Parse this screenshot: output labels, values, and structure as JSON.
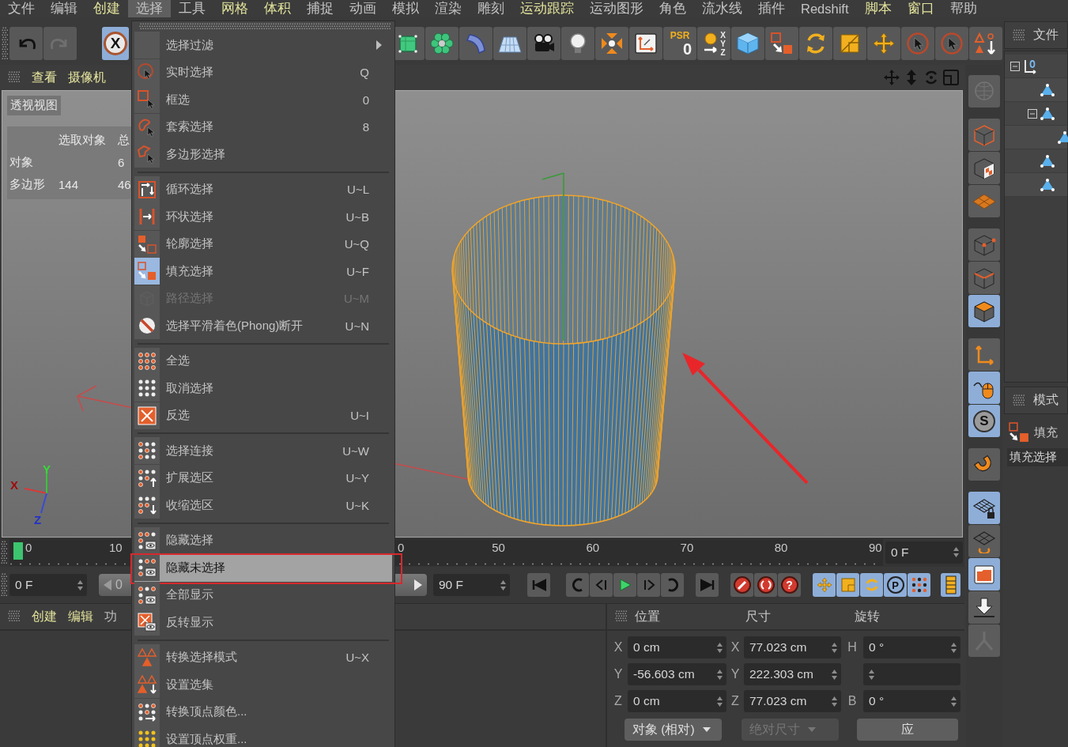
{
  "menu_bar": [
    {
      "label": "文件",
      "highlighted": false,
      "selected": false
    },
    {
      "label": "编辑",
      "highlighted": false,
      "selected": false
    },
    {
      "label": "创建",
      "highlighted": true,
      "selected": false
    },
    {
      "label": "选择",
      "highlighted": false,
      "selected": true
    },
    {
      "label": "工具",
      "highlighted": false,
      "selected": false
    },
    {
      "label": "网格",
      "highlighted": true,
      "selected": false
    },
    {
      "label": "体积",
      "highlighted": true,
      "selected": false
    },
    {
      "label": "捕捉",
      "highlighted": false,
      "selected": false
    },
    {
      "label": "动画",
      "highlighted": false,
      "selected": false
    },
    {
      "label": "模拟",
      "highlighted": false,
      "selected": false
    },
    {
      "label": "渲染",
      "highlighted": false,
      "selected": false
    },
    {
      "label": "雕刻",
      "highlighted": false,
      "selected": false
    },
    {
      "label": "运动跟踪",
      "highlighted": true,
      "selected": false
    },
    {
      "label": "运动图形",
      "highlighted": false,
      "selected": false
    },
    {
      "label": "角色",
      "highlighted": false,
      "selected": false
    },
    {
      "label": "流水线",
      "highlighted": false,
      "selected": false
    },
    {
      "label": "插件",
      "highlighted": false,
      "selected": false
    },
    {
      "label": "Redshift",
      "highlighted": false,
      "selected": false
    },
    {
      "label": "脚本",
      "highlighted": true,
      "selected": false
    },
    {
      "label": "窗口",
      "highlighted": true,
      "selected": false
    },
    {
      "label": "帮助",
      "highlighted": false,
      "selected": false
    }
  ],
  "toolbar": {
    "undo": {
      "disabled": false
    },
    "redo": {
      "disabled": true
    },
    "mode_button": {
      "label": "X",
      "selected": true
    },
    "psr_button": {
      "label": "PSR",
      "value": "0"
    },
    "axis_button": {
      "letters": [
        "X",
        "Y",
        "Z"
      ]
    }
  },
  "select_menu": {
    "groups": [
      [
        {
          "label": "选择过滤",
          "submenu": true,
          "selected": false,
          "disabled": false,
          "active": false,
          "outlined": false
        },
        {
          "label": "实时选择",
          "shortcut": "Q",
          "submenu": false,
          "selected": false,
          "disabled": false,
          "active": false,
          "outlined": false
        },
        {
          "label": "框选",
          "shortcut": "0",
          "submenu": false,
          "selected": false,
          "disabled": false,
          "active": false,
          "outlined": false
        },
        {
          "label": "套索选择",
          "shortcut": "8",
          "submenu": false,
          "selected": false,
          "disabled": false,
          "active": false,
          "outlined": false
        },
        {
          "label": "多边形选择",
          "submenu": false,
          "selected": false,
          "disabled": false,
          "active": false,
          "outlined": false
        }
      ],
      [
        {
          "label": "循环选择",
          "shortcut": "U~L",
          "submenu": false,
          "selected": false,
          "disabled": false,
          "active": false,
          "outlined": false
        },
        {
          "label": "环状选择",
          "shortcut": "U~B",
          "submenu": false,
          "selected": false,
          "disabled": false,
          "active": false,
          "outlined": false
        },
        {
          "label": "轮廓选择",
          "shortcut": "U~Q",
          "submenu": false,
          "selected": false,
          "disabled": false,
          "active": false,
          "outlined": false
        },
        {
          "label": "填充选择",
          "shortcut": "U~F",
          "submenu": false,
          "selected": false,
          "disabled": false,
          "active": true,
          "outlined": false
        },
        {
          "label": "路径选择",
          "shortcut": "U~M",
          "submenu": false,
          "selected": false,
          "disabled": true,
          "active": false,
          "outlined": false
        },
        {
          "label": "选择平滑着色(Phong)断开",
          "shortcut": "U~N",
          "submenu": false,
          "selected": false,
          "disabled": false,
          "active": false,
          "outlined": false
        }
      ],
      [
        {
          "label": "全选",
          "submenu": false,
          "selected": false,
          "disabled": false,
          "active": false,
          "outlined": false
        },
        {
          "label": "取消选择",
          "submenu": false,
          "selected": false,
          "disabled": false,
          "active": false,
          "outlined": false
        },
        {
          "label": "反选",
          "shortcut": "U~I",
          "submenu": false,
          "selected": false,
          "disabled": false,
          "active": false,
          "outlined": false
        }
      ],
      [
        {
          "label": "选择连接",
          "shortcut": "U~W",
          "submenu": false,
          "selected": false,
          "disabled": false,
          "active": false,
          "outlined": false
        },
        {
          "label": "扩展选区",
          "shortcut": "U~Y",
          "submenu": false,
          "selected": false,
          "disabled": false,
          "active": false,
          "outlined": false
        },
        {
          "label": "收缩选区",
          "shortcut": "U~K",
          "submenu": false,
          "selected": false,
          "disabled": false,
          "active": false,
          "outlined": false
        }
      ],
      [
        {
          "label": "隐藏选择",
          "submenu": false,
          "selected": false,
          "disabled": false,
          "active": false,
          "outlined": false
        },
        {
          "label": "隐藏未选择",
          "submenu": false,
          "selected": true,
          "disabled": false,
          "active": false,
          "outlined": true
        },
        {
          "label": "全部显示",
          "submenu": false,
          "selected": false,
          "disabled": false,
          "active": false,
          "outlined": false
        },
        {
          "label": "反转显示",
          "submenu": false,
          "selected": false,
          "disabled": false,
          "active": false,
          "outlined": false
        }
      ],
      [
        {
          "label": "转换选择模式",
          "shortcut": "U~X",
          "submenu": false,
          "selected": false,
          "disabled": false,
          "active": false,
          "outlined": false
        },
        {
          "label": "设置选集",
          "submenu": false,
          "selected": false,
          "disabled": false,
          "active": false,
          "outlined": false
        },
        {
          "label": "转换顶点颜色...",
          "submenu": false,
          "selected": false,
          "disabled": false,
          "active": false,
          "outlined": false
        },
        {
          "label": "设置顶点权重...",
          "submenu": false,
          "selected": false,
          "disabled": false,
          "active": false,
          "outlined": false
        }
      ]
    ]
  },
  "viewport": {
    "menu": [
      {
        "label": "查看",
        "highlighted": true
      },
      {
        "label": "摄像机",
        "highlighted": true
      }
    ],
    "title": "透视视图",
    "stats": {
      "columns": [
        "选取对象",
        "总"
      ],
      "rows": [
        {
          "name": "对象",
          "total": "6"
        },
        {
          "name": "多边形",
          "picked": "144",
          "total": "46"
        }
      ]
    },
    "gizmo_labels": [
      "X",
      "Y",
      "Z"
    ]
  },
  "timeline": {
    "left_labels": [
      "0",
      "10"
    ],
    "right_labels": [
      "0",
      "50",
      "60",
      "70",
      "80",
      "90"
    ],
    "playhead": {
      "level": 0
    },
    "current_frame": "0 F"
  },
  "transport": {
    "start_field": "0 F",
    "range": {
      "start": "0",
      "level": 1
    },
    "end_field": "90 F",
    "help_label": "?",
    "key_buttons": [
      {
        "on": true
      },
      {
        "on": true
      },
      {
        "on": true
      },
      {
        "on": true,
        "label": "P"
      },
      {
        "on": true
      }
    ],
    "timeline_button": {
      "on": true
    }
  },
  "material_panel": {
    "menu": [
      {
        "label": "创建",
        "highlighted": true
      },
      {
        "label": "编辑",
        "highlighted": true
      },
      {
        "label": "功",
        "highlighted": false
      }
    ]
  },
  "coordinates": {
    "headers": [
      "位置",
      "尺寸",
      "旋转"
    ],
    "rows": [
      {
        "position_axis": "X",
        "position": "0 cm",
        "size_axis": "X",
        "size": "77.023 cm",
        "rotation_axis": "H",
        "rotation": "0 °"
      },
      {
        "position_axis": "Y",
        "position": "-56.603 cm",
        "size_axis": "Y",
        "size": "222.303 cm"
      },
      {
        "position_axis": "Z",
        "position": "0 cm",
        "size_axis": "Z",
        "size": "77.023 cm",
        "rotation_axis": "B",
        "rotation": "0 °"
      }
    ],
    "mode_dropdown": "对象 (相对)",
    "size_dropdown": {
      "label": "绝对尺寸",
      "disabled": true
    },
    "apply_button": "应"
  },
  "tool_palette": {
    "groups": [
      [
        {
          "selected": false,
          "disabled": true
        }
      ],
      [
        {
          "selected": false,
          "disabled": false
        },
        {
          "selected": false,
          "disabled": false
        },
        {
          "selected": false,
          "disabled": false
        }
      ],
      [
        {
          "selected": false,
          "disabled": false
        },
        {
          "selected": false,
          "disabled": false
        },
        {
          "selected": true,
          "disabled": false
        }
      ],
      [
        {
          "selected": false,
          "disabled": false
        },
        {
          "selected": true,
          "disabled": false
        },
        {
          "selected": true,
          "disabled": false,
          "label": "S"
        }
      ],
      [
        {
          "selected": false,
          "disabled": false
        }
      ],
      [
        {
          "selected": true,
          "disabled": false
        },
        {
          "selected": false,
          "disabled": false
        },
        {
          "selected": true,
          "disabled": false
        },
        {
          "selected": false,
          "disabled": false
        },
        {
          "selected": false,
          "disabled": true
        }
      ]
    ]
  },
  "object_manager": {
    "tab": "文件",
    "tree": [
      {
        "kind": "null",
        "expanded": true,
        "children": [
          {
            "kind": "polygon"
          },
          {
            "kind": "polygon",
            "expanded": true,
            "children": [
              {
                "kind": "polygon"
              }
            ]
          },
          {
            "kind": "polygon"
          },
          {
            "kind": "polygon"
          }
        ]
      }
    ]
  },
  "attributes": {
    "tab": "模式",
    "mode_label": "填充",
    "title": "填充选择"
  }
}
